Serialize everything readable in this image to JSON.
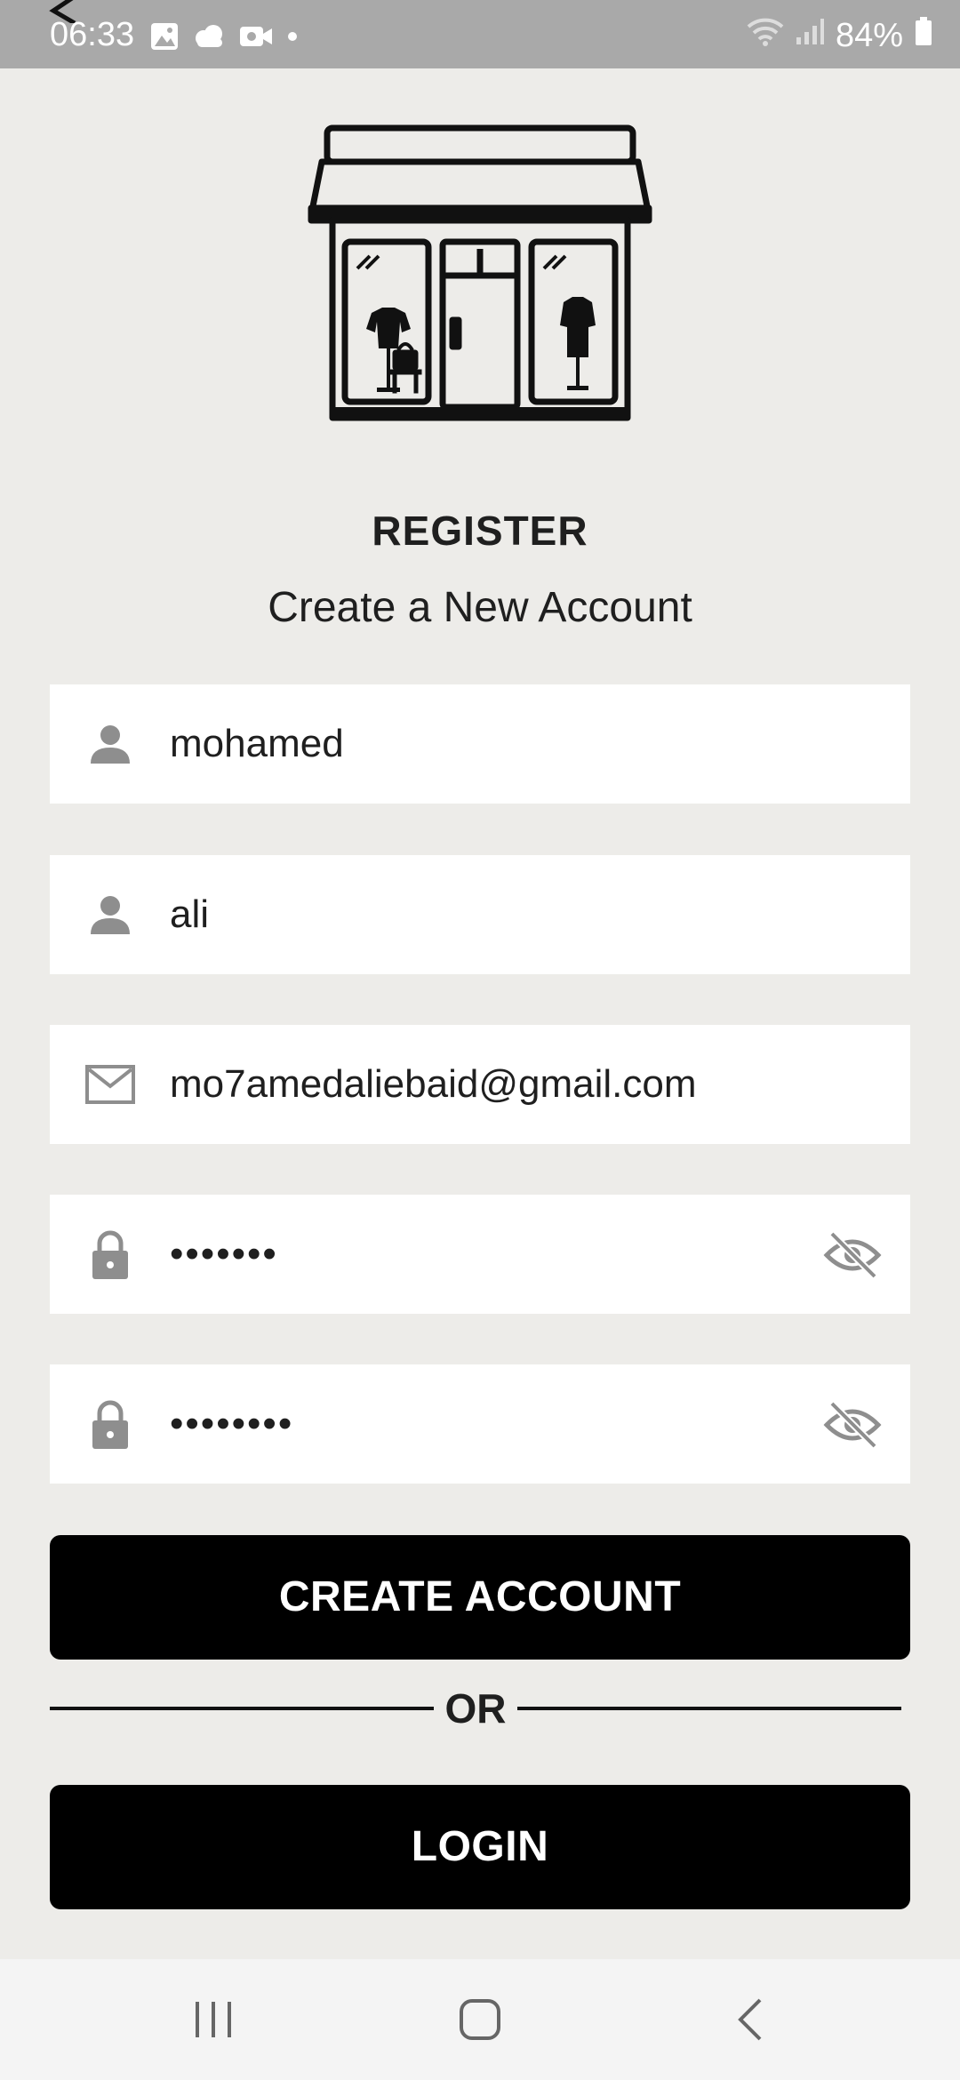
{
  "status_bar": {
    "time": "06:33",
    "battery": "84%",
    "icons": [
      "gallery-icon",
      "cloud-icon",
      "video-icon",
      "dot-icon",
      "wifi-icon",
      "signal-icon",
      "battery-icon"
    ]
  },
  "header": {
    "illustration": "store-icon",
    "title": "REGISTER",
    "subtitle": "Create a New Account"
  },
  "form": {
    "first_name": {
      "icon": "person-icon",
      "value": "mohamed"
    },
    "last_name": {
      "icon": "person-icon",
      "value": "ali"
    },
    "email": {
      "icon": "mail-icon",
      "value": "mo7amedaliebaid@gmail.com"
    },
    "password": {
      "icon": "lock-icon",
      "value": "•••••••",
      "toggle_icon": "eye-off-icon"
    },
    "confirm_password": {
      "icon": "lock-icon",
      "value": "••••••••",
      "toggle_icon": "eye-off-icon"
    }
  },
  "actions": {
    "create_account_label": "CREATE ACCOUNT",
    "divider_label": "OR",
    "login_label": "LOGIN"
  },
  "colors": {
    "background": "#edece9",
    "status_bar": "#a9a9a9",
    "field_background": "#ffffff",
    "button_background": "#000000",
    "icon_gray": "#8e8e8e"
  },
  "nav_bar": {
    "items": [
      "recent-apps-icon",
      "home-icon",
      "back-icon"
    ]
  }
}
